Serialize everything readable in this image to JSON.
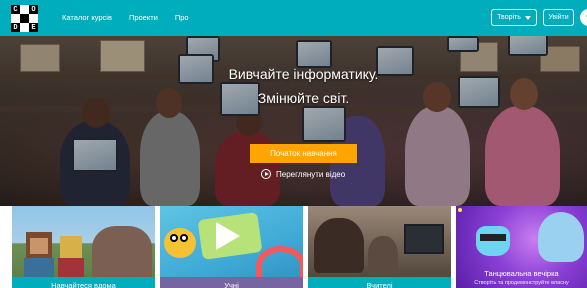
{
  "header": {
    "logo_letters": [
      "C",
      "O",
      "D",
      "E"
    ],
    "nav": [
      {
        "label": "Каталог курсів"
      },
      {
        "label": "Проекти"
      },
      {
        "label": "Про"
      }
    ],
    "create_label": "Творіть",
    "signin_label": "Увійти",
    "accent_color": "#00adbc"
  },
  "hero": {
    "title_line1": "Вивчайте інформатику.",
    "title_line2": "Змінюйте світ.",
    "cta_label": "Початок навчання",
    "cta_color": "#ffa400",
    "watch_label": "Переглянути відео"
  },
  "cards": [
    {
      "label": "Навчайтеся вдома",
      "color": "#00adbc"
    },
    {
      "label": "Учні",
      "color": "#7665a0"
    },
    {
      "label": "Вчителі",
      "color": "#00adbc"
    },
    {
      "label": "Танцювальна вечірка",
      "sub": "Створіть та продемонструйте власну",
      "color": "#7a5bd0"
    }
  ]
}
